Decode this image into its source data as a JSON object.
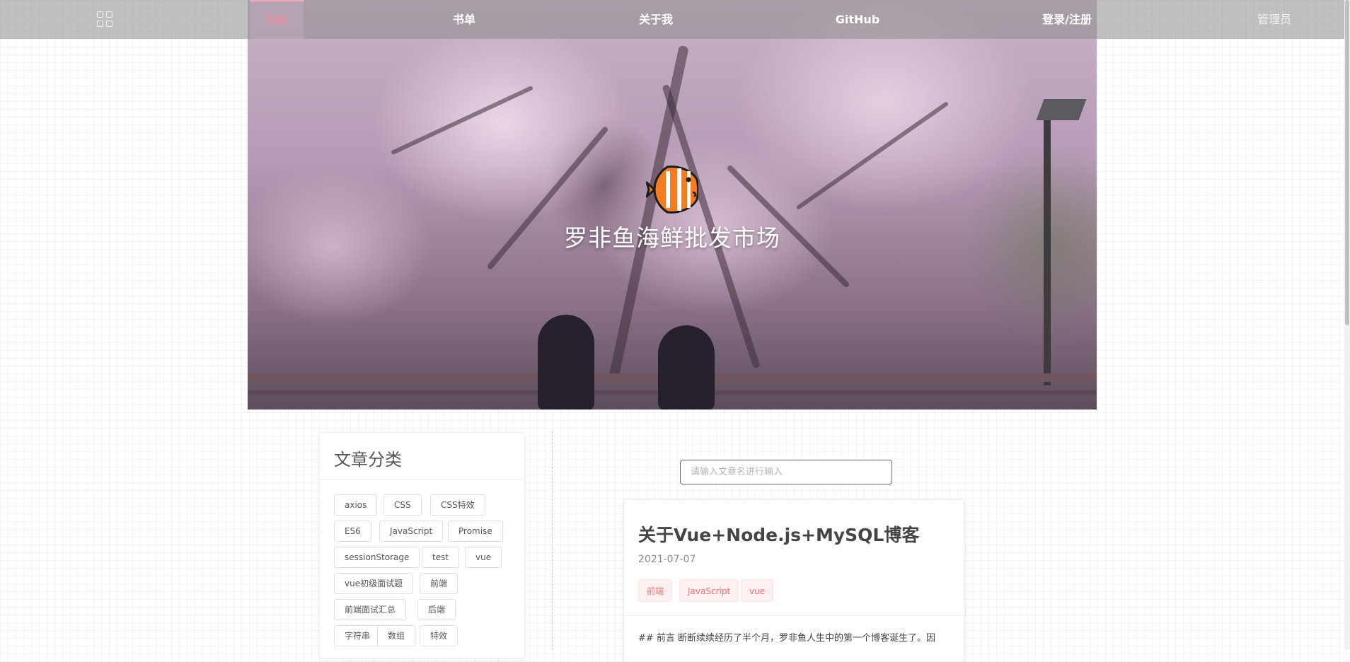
{
  "navbar": {
    "items": [
      {
        "label": "归档",
        "active": true
      },
      {
        "label": "书单"
      },
      {
        "label": "关于我"
      },
      {
        "label": "GitHub"
      },
      {
        "label": "登录/注册"
      },
      {
        "label": "管理员"
      }
    ]
  },
  "hero": {
    "title": "罗非鱼海鲜批发市场",
    "logo_icon": "fish-icon"
  },
  "sidebar": {
    "title": "文章分类",
    "tags": [
      "axios",
      "CSS",
      "CSS特效",
      "ES6",
      "JavaScript",
      "Promise",
      "sessionStorage",
      "test",
      "vue",
      "vue初级面试题",
      "前端",
      "前端面试汇总",
      "后端",
      "字符串",
      "数组",
      "特效"
    ]
  },
  "search": {
    "placeholder": "请输入文章名进行输入"
  },
  "article": {
    "title": "关于Vue+Node.js+MySQL博客",
    "date": "2021-07-07",
    "tags": [
      "前端",
      "JavaScript",
      "vue"
    ],
    "excerpt": "## 前言 断断续续经历了半个月，罗非鱼人生中的第一个博客诞生了。因"
  },
  "colors": {
    "accent": "#f38aa0",
    "tag_text": "#f56c6c",
    "tag_bg": "#fef0f0"
  }
}
